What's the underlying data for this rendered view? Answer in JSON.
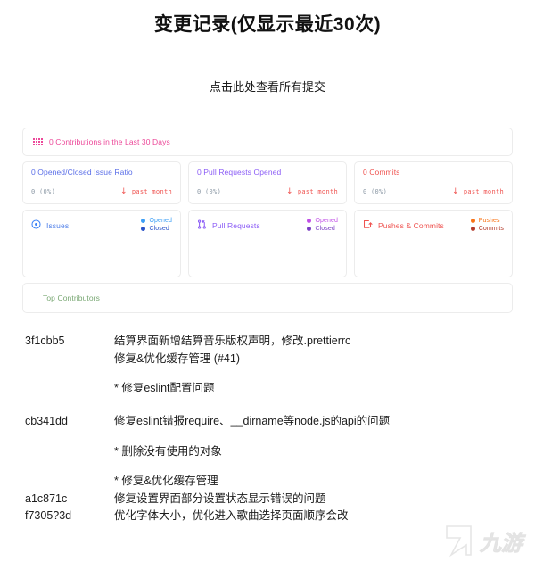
{
  "header": {
    "title": "变更记录(仅显示最近30次)",
    "all_commits_link": "点击此处查看所有提交"
  },
  "metrics": {
    "contributions": {
      "label": "0 Contributions in the Last 30 Days",
      "icon": "grid-icon",
      "color": "#ec4899"
    },
    "stats": [
      {
        "title": "0 Opened/Closed Issue Ratio",
        "title_color": "#5b6fe8",
        "delta": "0 (0%)",
        "trend_label": "past month",
        "trend_arrow": "↓",
        "trend_color": "#ef5350"
      },
      {
        "title": "0 Pull Requests Opened",
        "title_color": "#8b5cf6",
        "delta": "0 (0%)",
        "trend_label": "past month",
        "trend_arrow": "↓",
        "trend_color": "#ef5350"
      },
      {
        "title": "0 Commits",
        "title_color": "#ef5350",
        "delta": "0 (0%)",
        "trend_label": "past month",
        "trend_arrow": "↓",
        "trend_color": "#ef5350"
      }
    ],
    "charts": [
      {
        "title": "Issues",
        "title_color": "#4f7fe8",
        "icon": "issue-opened-icon",
        "icon_color": "#3b82f6",
        "legend": [
          {
            "label": "Opened",
            "color": "#3b9ef5"
          },
          {
            "label": "Closed",
            "color": "#2952c8"
          }
        ]
      },
      {
        "title": "Pull Requests",
        "title_color": "#8b5cf6",
        "icon": "git-pull-request-icon",
        "icon_color": "#8b5cf6",
        "legend": [
          {
            "label": "Opened",
            "color": "#c04ee6"
          },
          {
            "label": "Closed",
            "color": "#7c3fc4"
          }
        ]
      },
      {
        "title": "Pushes & Commits",
        "title_color": "#ef5350",
        "icon": "repo-push-icon",
        "icon_color": "#ef5350",
        "legend": [
          {
            "label": "Pushes",
            "color": "#f97316"
          },
          {
            "label": "Commits",
            "color": "#b33a2a"
          }
        ]
      }
    ],
    "top_contributors": {
      "label": "Top Contributors",
      "color": "#7aa874"
    }
  },
  "commits": [
    {
      "hash": "3f1cbb5",
      "message_lines": [
        "结算界面新增结算音乐版权声明，修改.prettierrc",
        " 修复&优化缓存管理 (#41)"
      ],
      "sub_lines": [
        "* 修复eslint配置问题"
      ]
    },
    {
      "hash": "cb341dd",
      "message_lines": [
        "修复eslint错报require、__dirname等node.js的api的问题"
      ],
      "sub_lines": [
        "* 删除没有使用的对象",
        "* 修复&优化缓存管理"
      ]
    },
    {
      "hash": "a1c871c",
      "message_lines": [
        "修复设置界面部分设置状态显示错误的问题"
      ],
      "sub_lines": []
    },
    {
      "hash": "f7305?3d",
      "message_lines": [
        "优化字体大小，优化进入歌曲选择页面顺序会改"
      ],
      "sub_lines": []
    }
  ],
  "watermark": {
    "text": "九游"
  }
}
